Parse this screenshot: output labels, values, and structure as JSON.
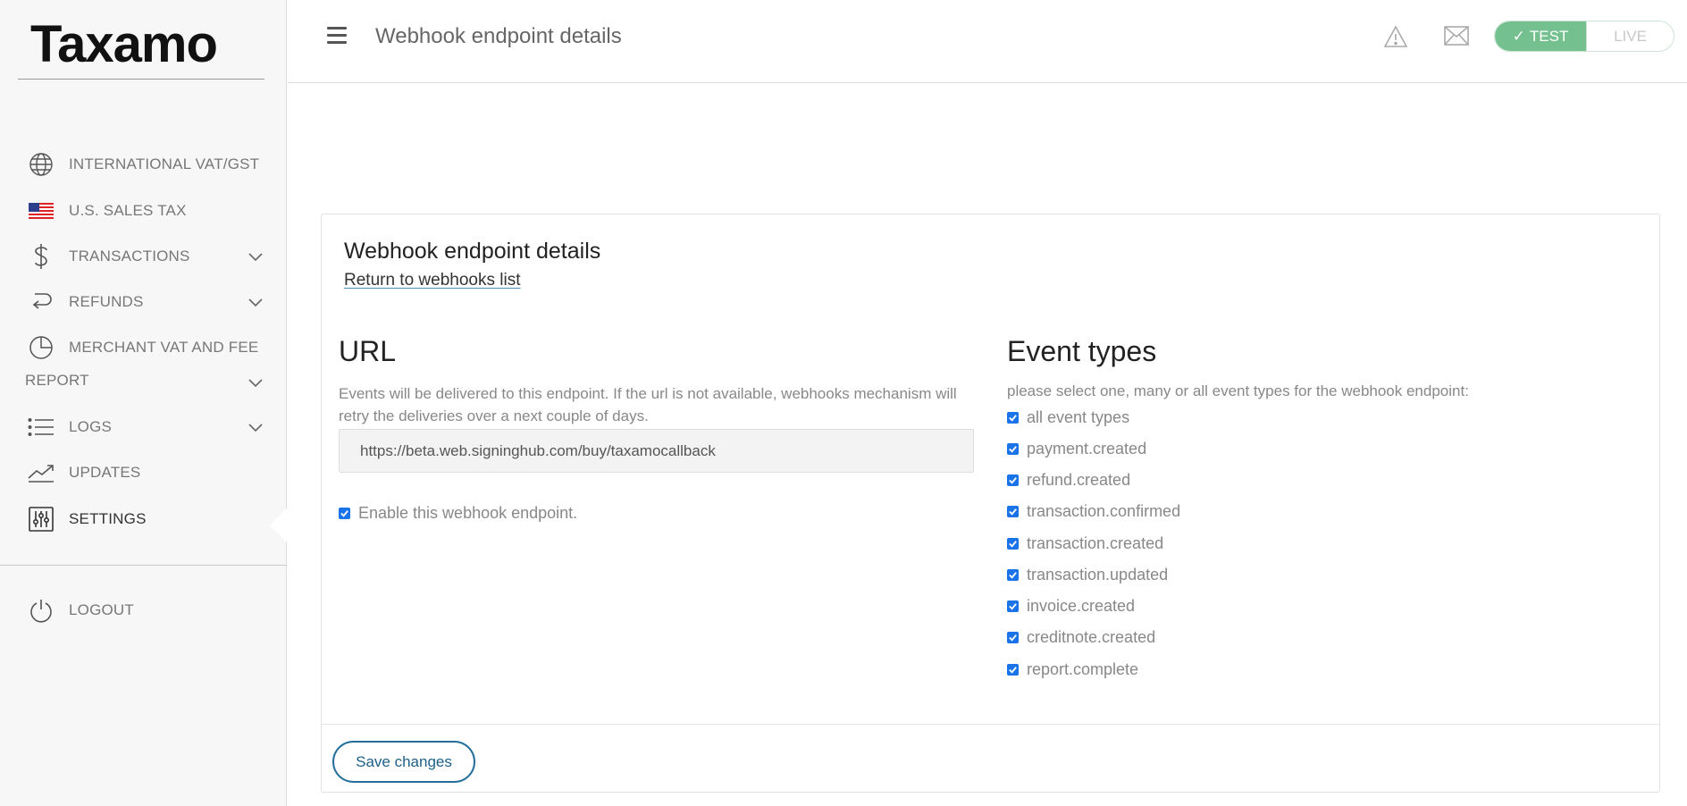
{
  "app": {
    "logo": "Taxamo"
  },
  "sidebar": {
    "items": [
      {
        "label": "INTERNATIONAL VAT/GST",
        "icon": "globe-icon"
      },
      {
        "label": "U.S. SALES TAX",
        "icon": "us-flag-icon"
      },
      {
        "label": "TRANSACTIONS",
        "icon": "dollar-icon"
      },
      {
        "label": "REFUNDS",
        "icon": "refund-icon"
      },
      {
        "label": "MERCHANT VAT AND FEE",
        "icon": "pie-chart-icon"
      },
      {
        "label": "LOGS",
        "icon": "list-icon"
      },
      {
        "label": "UPDATES",
        "icon": "trend-icon"
      },
      {
        "label": "SETTINGS",
        "icon": "sliders-icon"
      }
    ],
    "report_label": "REPORT",
    "logout_label": "LOGOUT"
  },
  "header": {
    "title": "Webhook endpoint details",
    "env_test": "TEST",
    "env_live": "LIVE"
  },
  "card": {
    "title": "Webhook endpoint details",
    "return_link": "Return to webhooks list",
    "url_title": "URL",
    "url_description": "Events will be delivered to this endpoint. If the url is not available, webhooks mechanism will retry the deliveries over a next couple of days.",
    "url_value": "https://beta.web.signinghub.com/buy/taxamocallback",
    "enable_label": "Enable this webhook endpoint.",
    "events_title": "Event types",
    "events_description": "please select one, many or all event types for the webhook endpoint:",
    "events": [
      "all event types",
      "payment.created",
      "refund.created",
      "transaction.confirmed",
      "transaction.created",
      "transaction.updated",
      "invoice.created",
      "creditnote.created",
      "report.complete"
    ],
    "save_label": "Save changes"
  },
  "colors": {
    "accent": "#1d5f88",
    "test_green": "#74c08f",
    "checkbox": "#1a73e8"
  }
}
